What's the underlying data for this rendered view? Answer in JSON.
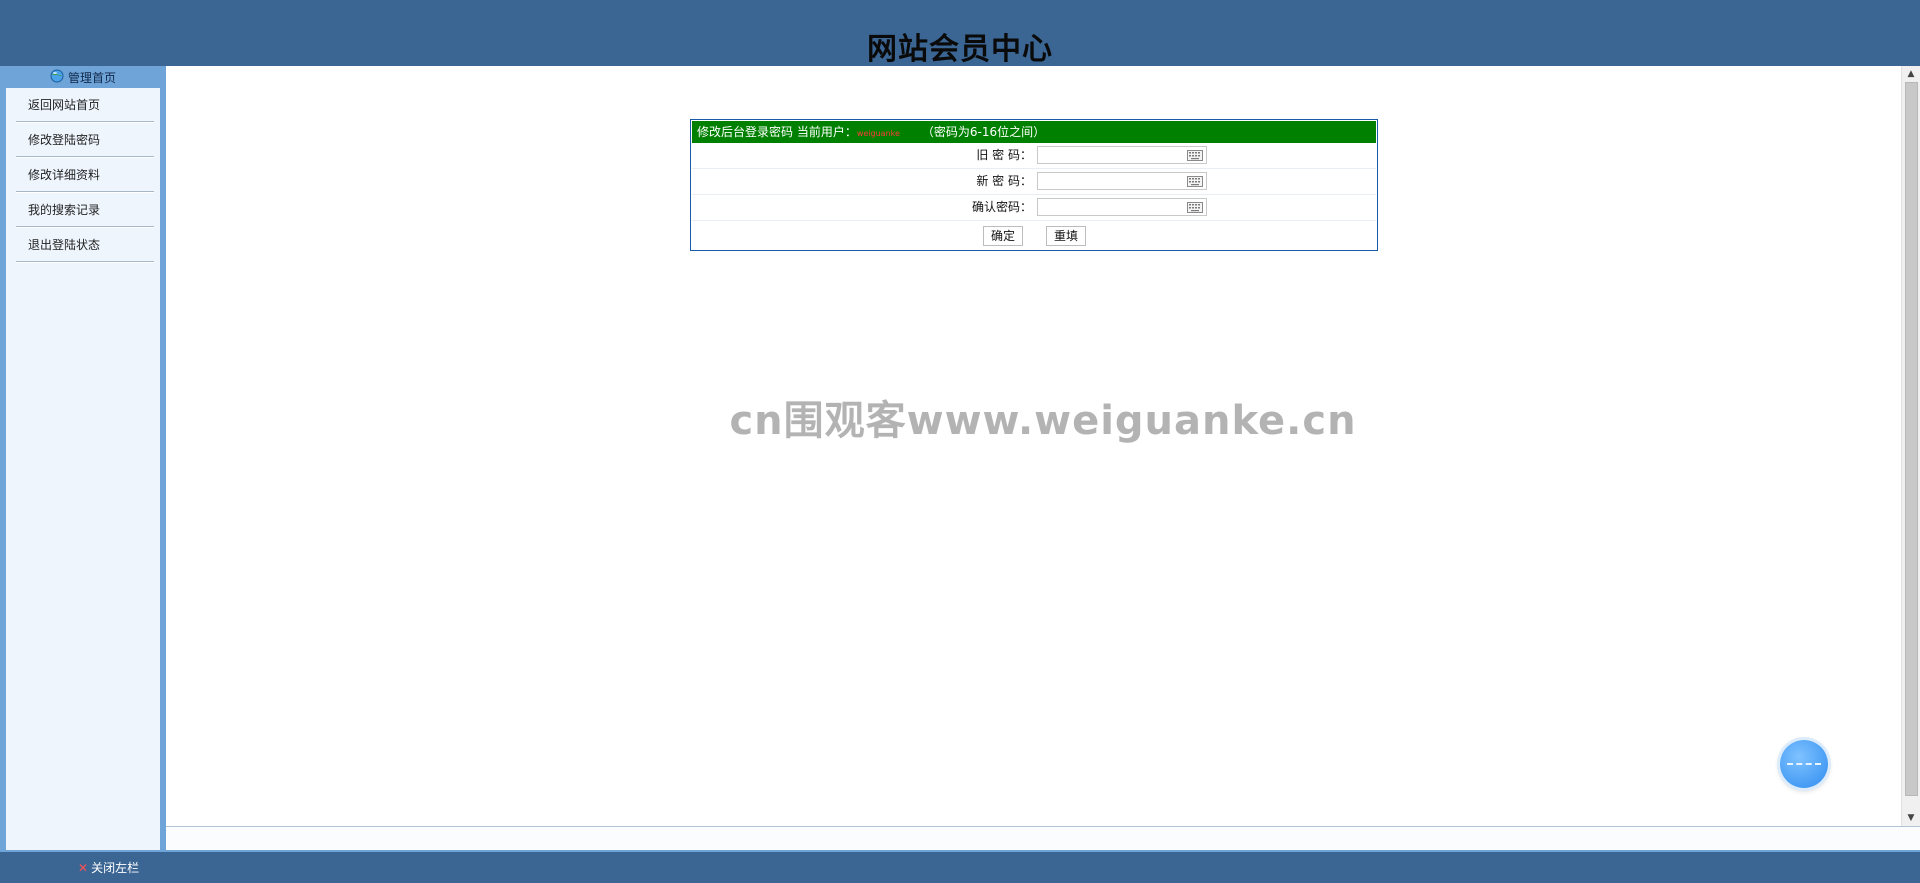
{
  "header": {
    "title": "网站会员中心"
  },
  "sidebar": {
    "header_label": "管理首页",
    "items": [
      {
        "label": "返回网站首页"
      },
      {
        "label": "修改登陆密码"
      },
      {
        "label": "修改详细资料"
      },
      {
        "label": "我的搜索记录"
      },
      {
        "label": "退出登陆状态"
      }
    ]
  },
  "form": {
    "heading_prefix": "修改后台登录密码 当前用户：",
    "current_user": "weiguanke",
    "hint": "（密码为6-16位之间）",
    "fields": [
      {
        "label": "旧 密 码：",
        "value": ""
      },
      {
        "label": "新 密 码：",
        "value": ""
      },
      {
        "label": "确认密码：",
        "value": ""
      }
    ],
    "submit_label": "确定",
    "reset_label": "重填"
  },
  "watermark": "cn围观客www.weiguanke.cn",
  "footer": {
    "close_label": "关闭左栏"
  },
  "colors": {
    "topbar": "#3b6694",
    "sidebar": "#6fa4d8",
    "form_header": "#008000",
    "user_name": "#ff3b3b"
  }
}
